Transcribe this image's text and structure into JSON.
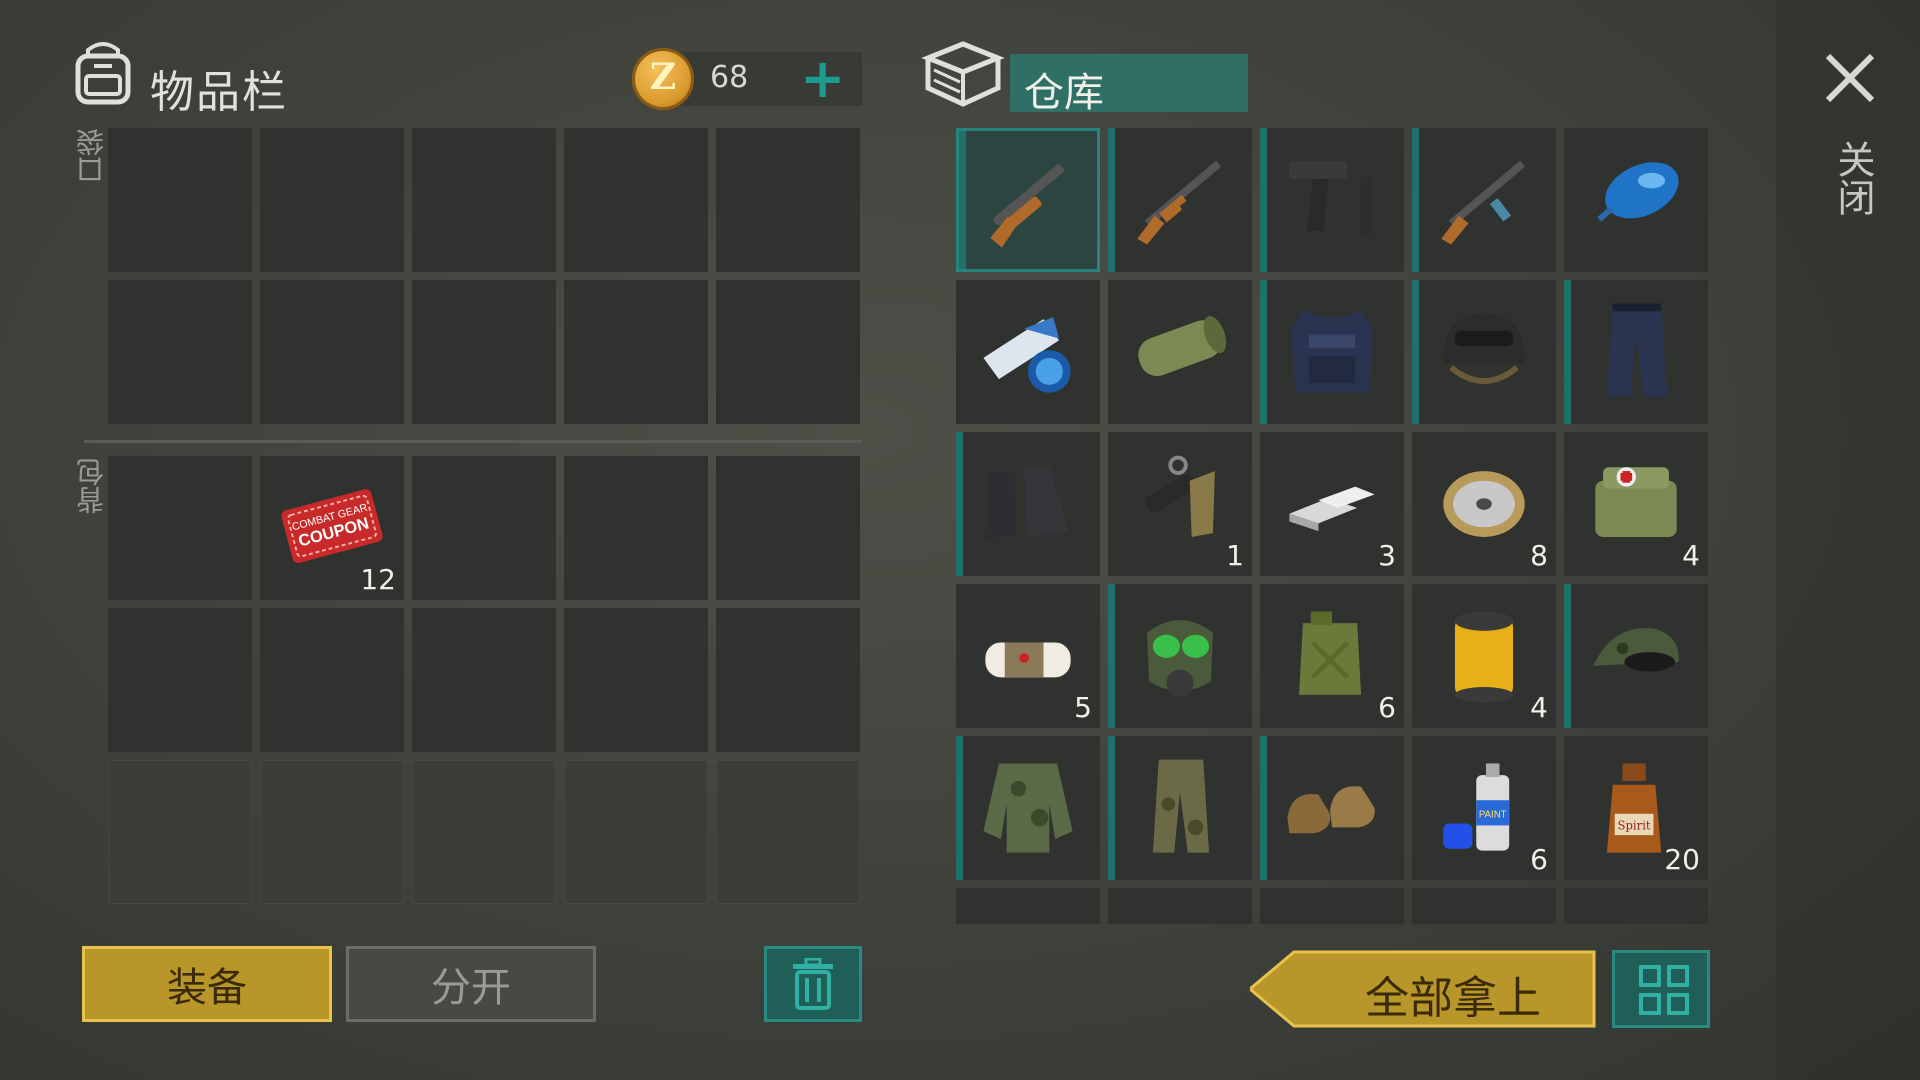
{
  "inventory": {
    "title": "物品栏",
    "coins": "68",
    "coin_symbol": "Z",
    "plus": "+",
    "pocket_label": "口袋",
    "backpack_label": "背包",
    "backpack_items": [
      {
        "slot": 1,
        "icon": "combat-gear-coupon-icon",
        "count": "12",
        "lines": [
          "COMBAT GEAR",
          "COUPON"
        ]
      }
    ]
  },
  "warehouse": {
    "title": "仓库",
    "items": [
      {
        "icon": "shotgun-icon",
        "count": "",
        "selected": true,
        "equip": true
      },
      {
        "icon": "ak47-rifle-icon",
        "count": "",
        "equip": true
      },
      {
        "icon": "pistol-with-silencer-icon",
        "count": "",
        "equip": true
      },
      {
        "icon": "scoped-assault-rifle-icon",
        "count": "",
        "equip": true
      },
      {
        "icon": "blue-fuel-tank-icon",
        "count": ""
      },
      {
        "icon": "magazine-and-tape-icon",
        "count": ""
      },
      {
        "icon": "green-cylinder-icon",
        "count": ""
      },
      {
        "icon": "police-vest-icon",
        "count": "",
        "equip": true
      },
      {
        "icon": "tactical-helmet-icon",
        "count": "",
        "equip": true
      },
      {
        "icon": "police-pants-icon",
        "count": "",
        "equip": true
      },
      {
        "icon": "combat-boots-icon",
        "count": "",
        "equip": true
      },
      {
        "icon": "gun-parts-icon",
        "count": "1"
      },
      {
        "icon": "metal-bars-icon",
        "count": "3"
      },
      {
        "icon": "wire-spool-icon",
        "count": "8"
      },
      {
        "icon": "first-aid-bag-icon",
        "count": "4"
      },
      {
        "icon": "bandage-icon",
        "count": "5"
      },
      {
        "icon": "gas-mask-icon",
        "count": "",
        "equip": true
      },
      {
        "icon": "jerry-can-icon",
        "count": "6"
      },
      {
        "icon": "air-filter-icon",
        "count": "4"
      },
      {
        "icon": "camo-cap-sunglasses-icon",
        "count": "",
        "equip": true
      },
      {
        "icon": "camo-jacket-icon",
        "count": "",
        "equip": true
      },
      {
        "icon": "camo-pants-icon",
        "count": "",
        "equip": true
      },
      {
        "icon": "brown-shoes-icon",
        "count": "",
        "equip": true
      },
      {
        "icon": "spray-paint-icon",
        "count": "6",
        "label": "PAINT"
      },
      {
        "icon": "spirit-bottle-icon",
        "count": "20",
        "label": "Spirit"
      }
    ]
  },
  "close_label": "关闭",
  "buttons": {
    "equip": "装备",
    "split": "分开",
    "take_all": "全部拿上"
  },
  "colors": {
    "teal": "#26847c",
    "gold": "#b8962a"
  }
}
